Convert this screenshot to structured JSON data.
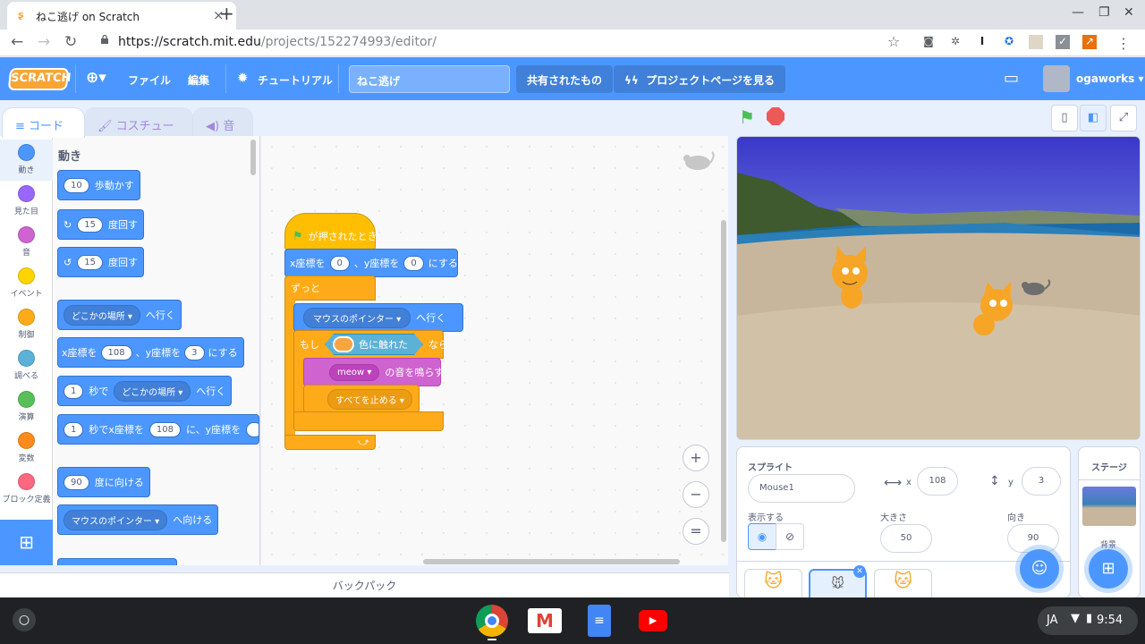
{
  "browser": {
    "tab_title": "ねこ逃げ on Scratch",
    "tab_close": "×",
    "new_tab": "+",
    "url_host": "https://scratch.mit.edu",
    "url_path": "/projects/152274993/editor/",
    "window_min": "—",
    "window_max": "❐",
    "window_close": "✕"
  },
  "menubar": {
    "logo": "SCRATCH",
    "file": "ファイル",
    "edit": "編集",
    "tutorial": "チュートリアル",
    "project_title": "ねこ逃げ",
    "shared": "共有されたもの",
    "project_page": "プロジェクトページを見る",
    "username": "ogaworks"
  },
  "tabs": {
    "code": "コード",
    "costumes": "コスチューム",
    "sounds": "音"
  },
  "categories": [
    {
      "label": "動き",
      "color": "#4c97ff"
    },
    {
      "label": "見た目",
      "color": "#9966ff"
    },
    {
      "label": "音",
      "color": "#cf63cf"
    },
    {
      "label": "イベント",
      "color": "#ffd500"
    },
    {
      "label": "制御",
      "color": "#ffab19"
    },
    {
      "label": "調べる",
      "color": "#5cb1d6"
    },
    {
      "label": "演算",
      "color": "#59c059"
    },
    {
      "label": "変数",
      "color": "#ff8c1a"
    },
    {
      "label": "ブロック定義",
      "color": "#ff6680"
    }
  ],
  "palette": {
    "heading": "動き",
    "move_n": "10",
    "move_l": "歩動かす",
    "turn_r_n": "15",
    "turn_r_l": "度回す",
    "turn_l_n": "15",
    "turn_l_l": "度回す",
    "goto_d": "どこかの場所",
    "goto_l": "へ行く",
    "gotoxy_x_l": "x座標を",
    "gotoxy_x": "108",
    "gotoxy_y_l": "、y座標を",
    "gotoxy_y": "3",
    "gotoxy_end": "にする",
    "glide_n": "1",
    "glide_l": "秒で",
    "glide_d": "どこかの場所",
    "glide_end": "へ行く",
    "glidexy_n": "1",
    "glidexy_l": "秒でx座標を",
    "glidexy_x": "108",
    "glidexy_m": "に、y座標を",
    "point_n": "90",
    "point_l": "度に向ける",
    "pointto_d": "マウスのポインター",
    "pointto_l": "へ向ける"
  },
  "script": {
    "hat": "が押されたとき",
    "setxy_x_l": "x座標を",
    "setxy_x": "0",
    "setxy_y_l": "、y座標を",
    "setxy_y": "0",
    "setxy_end": "にする",
    "forever": "ずっと",
    "goto_d": "マウスのポインター",
    "goto_l": "へ行く",
    "if_l": "もし",
    "touch_l": "色に触れた",
    "then_l": "なら",
    "sound_d": "meow",
    "sound_l": "の音を鳴らす",
    "stop_d": "すべてを止める",
    "touch_color": "#f7a53f"
  },
  "zoom": {
    "in": "+",
    "out": "−",
    "reset": "="
  },
  "backpack": "バックパック",
  "sprite": {
    "label": "スプライト",
    "name": "Mouse1",
    "x_label": "x",
    "x": "108",
    "y_label": "y",
    "y": "3",
    "show_label": "表示する",
    "size_label": "大きさ",
    "size": "50",
    "dir_label": "向き",
    "dir": "90"
  },
  "stage_panel": {
    "label": "ステージ",
    "backdrop": "背景"
  },
  "shelf": {
    "lang": "JA",
    "time": "9:54"
  }
}
